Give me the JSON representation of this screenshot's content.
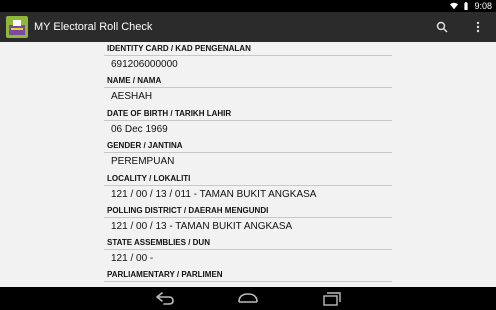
{
  "statusbar": {
    "time": "9:08"
  },
  "actionbar": {
    "title": "MY Electoral Roll Check"
  },
  "fields": [
    {
      "label": "IDENTITY CARD / KAD PENGENALAN",
      "value": "691206000000"
    },
    {
      "label": "NAME / NAMA",
      "value": "AESHAH"
    },
    {
      "label": "DATE OF BIRTH / TARIKH LAHIR",
      "value": "06 Dec 1969"
    },
    {
      "label": "GENDER / JANTINA",
      "value": "PEREMPUAN"
    },
    {
      "label": "LOCALITY / LOKALITI",
      "value": "121 / 00 / 13 / 011 - TAMAN BUKIT ANGKASA"
    },
    {
      "label": "POLLING DISTRICT / DAERAH MENGUNDI",
      "value": "121 / 00 / 13 - TAMAN BUKIT ANGKASA"
    },
    {
      "label": "STATE ASSEMBLIES / DUN",
      "value": "121 / 00 -"
    },
    {
      "label": "PARLIAMENTARY / PARLIMEN",
      "value": ""
    }
  ]
}
